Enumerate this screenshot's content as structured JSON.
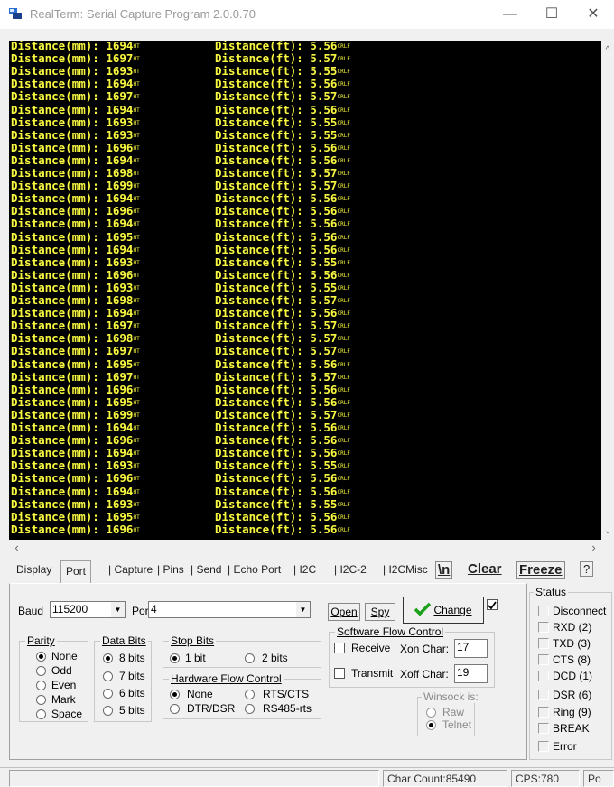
{
  "window": {
    "title": "RealTerm: Serial Capture Program 2.0.0.70",
    "minimize_glyph": "—",
    "maximize_glyph": "☐",
    "close_glyph": "✕"
  },
  "terminal": {
    "lines": [
      {
        "mm": "Distance(mm): 1694",
        "ft": "Distance(ft): 5.56"
      },
      {
        "mm": "Distance(mm): 1697",
        "ft": "Distance(ft): 5.57"
      },
      {
        "mm": "Distance(mm): 1693",
        "ft": "Distance(ft): 5.55"
      },
      {
        "mm": "Distance(mm): 1694",
        "ft": "Distance(ft): 5.56"
      },
      {
        "mm": "Distance(mm): 1697",
        "ft": "Distance(ft): 5.57"
      },
      {
        "mm": "Distance(mm): 1694",
        "ft": "Distance(ft): 5.56"
      },
      {
        "mm": "Distance(mm): 1693",
        "ft": "Distance(ft): 5.55"
      },
      {
        "mm": "Distance(mm): 1693",
        "ft": "Distance(ft): 5.55"
      },
      {
        "mm": "Distance(mm): 1696",
        "ft": "Distance(ft): 5.56"
      },
      {
        "mm": "Distance(mm): 1694",
        "ft": "Distance(ft): 5.56"
      },
      {
        "mm": "Distance(mm): 1698",
        "ft": "Distance(ft): 5.57"
      },
      {
        "mm": "Distance(mm): 1699",
        "ft": "Distance(ft): 5.57"
      },
      {
        "mm": "Distance(mm): 1694",
        "ft": "Distance(ft): 5.56"
      },
      {
        "mm": "Distance(mm): 1696",
        "ft": "Distance(ft): 5.56"
      },
      {
        "mm": "Distance(mm): 1694",
        "ft": "Distance(ft): 5.56"
      },
      {
        "mm": "Distance(mm): 1695",
        "ft": "Distance(ft): 5.56"
      },
      {
        "mm": "Distance(mm): 1694",
        "ft": "Distance(ft): 5.56"
      },
      {
        "mm": "Distance(mm): 1693",
        "ft": "Distance(ft): 5.55"
      },
      {
        "mm": "Distance(mm): 1696",
        "ft": "Distance(ft): 5.56"
      },
      {
        "mm": "Distance(mm): 1693",
        "ft": "Distance(ft): 5.55"
      },
      {
        "mm": "Distance(mm): 1698",
        "ft": "Distance(ft): 5.57"
      },
      {
        "mm": "Distance(mm): 1694",
        "ft": "Distance(ft): 5.56"
      },
      {
        "mm": "Distance(mm): 1697",
        "ft": "Distance(ft): 5.57"
      },
      {
        "mm": "Distance(mm): 1698",
        "ft": "Distance(ft): 5.57"
      },
      {
        "mm": "Distance(mm): 1697",
        "ft": "Distance(ft): 5.57"
      },
      {
        "mm": "Distance(mm): 1695",
        "ft": "Distance(ft): 5.56"
      },
      {
        "mm": "Distance(mm): 1697",
        "ft": "Distance(ft): 5.57"
      },
      {
        "mm": "Distance(mm): 1696",
        "ft": "Distance(ft): 5.56"
      },
      {
        "mm": "Distance(mm): 1695",
        "ft": "Distance(ft): 5.56"
      },
      {
        "mm": "Distance(mm): 1699",
        "ft": "Distance(ft): 5.57"
      },
      {
        "mm": "Distance(mm): 1694",
        "ft": "Distance(ft): 5.56"
      },
      {
        "mm": "Distance(mm): 1696",
        "ft": "Distance(ft): 5.56"
      },
      {
        "mm": "Distance(mm): 1694",
        "ft": "Distance(ft): 5.56"
      },
      {
        "mm": "Distance(mm): 1693",
        "ft": "Distance(ft): 5.55"
      },
      {
        "mm": "Distance(mm): 1696",
        "ft": "Distance(ft): 5.56"
      },
      {
        "mm": "Distance(mm): 1694",
        "ft": "Distance(ft): 5.56"
      },
      {
        "mm": "Distance(mm): 1693",
        "ft": "Distance(ft): 5.55"
      },
      {
        "mm": "Distance(mm): 1695",
        "ft": "Distance(ft): 5.56"
      },
      {
        "mm": "Distance(mm): 1696",
        "ft": "Distance(ft): 5.56"
      }
    ],
    "mm_suffix": "HT",
    "ft_suffix": "CRLF",
    "text_color": "#f8f840",
    "background": "#000000"
  },
  "tabs": [
    {
      "label": "Display",
      "active": false
    },
    {
      "label": "Port",
      "active": true
    },
    {
      "label": "Capture",
      "active": false
    },
    {
      "label": "Pins",
      "active": false
    },
    {
      "label": "Send",
      "active": false
    },
    {
      "label": "Echo Port",
      "active": false
    },
    {
      "label": "I2C",
      "active": false
    },
    {
      "label": "I2C-2",
      "active": false
    },
    {
      "label": "I2CMisc",
      "active": false
    }
  ],
  "tab_buttons": {
    "newline": "\\n",
    "clear": "Clear",
    "freeze": "Freeze",
    "help": "?"
  },
  "port": {
    "baud_label": "Baud",
    "baud_value": "115200",
    "port_label": "Port",
    "port_value": "4",
    "open_button": "Open",
    "spy_button": "Spy",
    "change_button": "Change",
    "change_checked": true,
    "parity": {
      "title": "Parity",
      "options": [
        "None",
        "Odd",
        "Even",
        "Mark",
        "Space"
      ],
      "selected": "None"
    },
    "data_bits": {
      "title": "Data Bits",
      "options": [
        "8 bits",
        "7 bits",
        "6 bits",
        "5 bits"
      ],
      "selected": "8 bits"
    },
    "stop_bits": {
      "title": "Stop Bits",
      "options": [
        "1 bit",
        "2 bits"
      ],
      "selected": "1 bit"
    },
    "hw_flow": {
      "title": "Hardware Flow Control",
      "options": [
        "None",
        "RTS/CTS",
        "DTR/DSR",
        "RS485-rts"
      ],
      "selected": "None"
    },
    "sw_flow": {
      "title": "Software Flow Control",
      "receive_label": "Receive",
      "transmit_label": "Transmit",
      "receive_checked": false,
      "transmit_checked": false,
      "xon_label": "Xon Char:",
      "xon_value": "17",
      "xoff_label": "Xoff Char:",
      "xoff_value": "19"
    },
    "winsock": {
      "title": "Winsock is:",
      "options": [
        "Raw",
        "Telnet"
      ],
      "selected": "Telnet"
    }
  },
  "status": {
    "title": "Status",
    "items": [
      "Disconnect",
      "RXD (2)",
      "TXD (3)",
      "CTS (8)",
      "DCD (1)",
      "DSR (6)",
      "Ring (9)",
      "BREAK",
      "Error"
    ]
  },
  "statusbar": {
    "char_count": "Char Count:85490",
    "cps": "CPS:780",
    "port_status": "Po"
  }
}
